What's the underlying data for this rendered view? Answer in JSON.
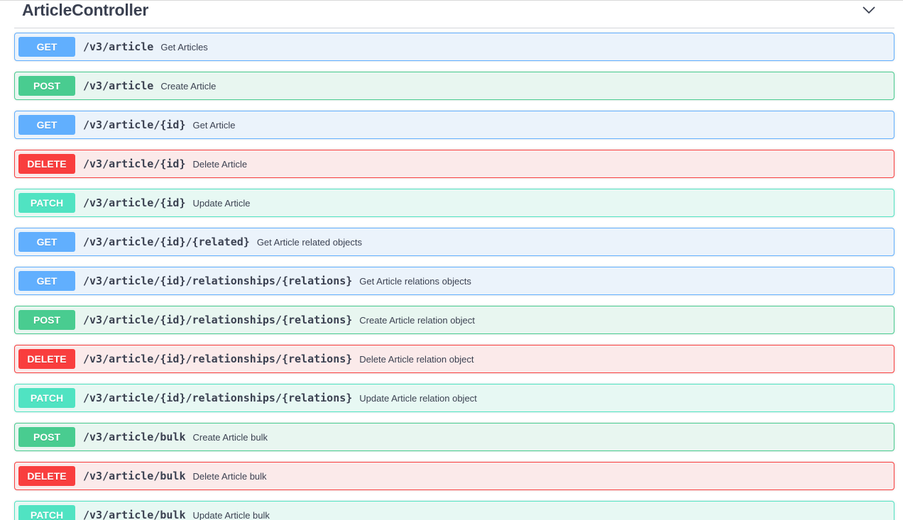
{
  "tag": {
    "title": "ArticleController",
    "collapse_icon": "chevron-down-icon"
  },
  "colors": {
    "get": "#61affe",
    "post": "#49cc90",
    "delete": "#f93e3e",
    "patch": "#50e3c2"
  },
  "operations": [
    {
      "method": "GET",
      "path": "/v3/article",
      "summary": "Get Articles"
    },
    {
      "method": "POST",
      "path": "/v3/article",
      "summary": "Create Article"
    },
    {
      "method": "GET",
      "path": "/v3/article/{id}",
      "summary": "Get Article"
    },
    {
      "method": "DELETE",
      "path": "/v3/article/{id}",
      "summary": "Delete Article"
    },
    {
      "method": "PATCH",
      "path": "/v3/article/{id}",
      "summary": "Update Article"
    },
    {
      "method": "GET",
      "path": "/v3/article/{id}/{related}",
      "summary": "Get Article related objects"
    },
    {
      "method": "GET",
      "path": "/v3/article/{id}/relationships/{relations}",
      "summary": "Get Article relations objects"
    },
    {
      "method": "POST",
      "path": "/v3/article/{id}/relationships/{relations}",
      "summary": "Create Article relation object"
    },
    {
      "method": "DELETE",
      "path": "/v3/article/{id}/relationships/{relations}",
      "summary": "Delete Article relation object"
    },
    {
      "method": "PATCH",
      "path": "/v3/article/{id}/relationships/{relations}",
      "summary": "Update Article relation object"
    },
    {
      "method": "POST",
      "path": "/v3/article/bulk",
      "summary": "Create Article bulk"
    },
    {
      "method": "DELETE",
      "path": "/v3/article/bulk",
      "summary": "Delete Article bulk"
    },
    {
      "method": "PATCH",
      "path": "/v3/article/bulk",
      "summary": "Update Article bulk"
    }
  ]
}
